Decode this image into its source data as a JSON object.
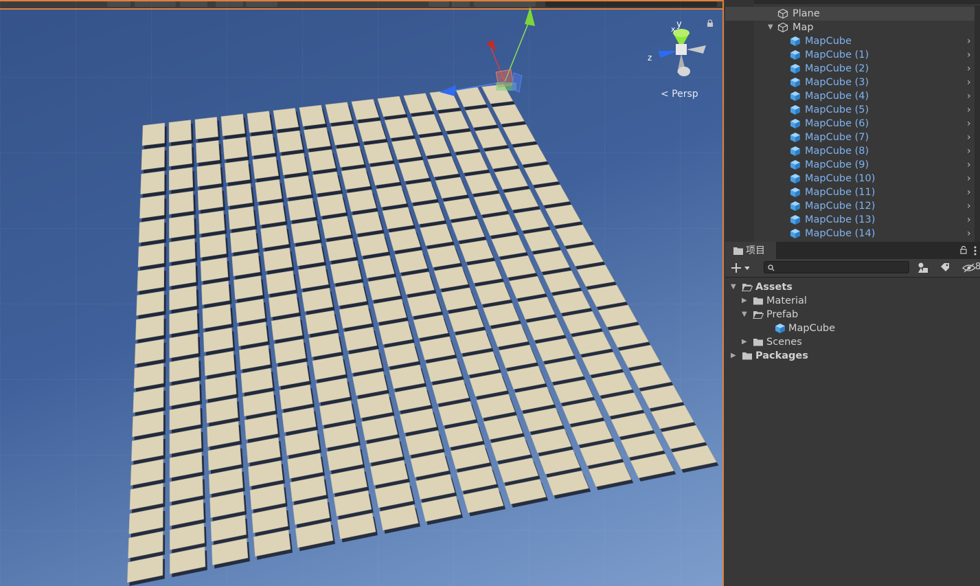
{
  "scene": {
    "projection_label": "< Persp",
    "gizmo_axes": {
      "y": "y",
      "x": "x",
      "z": "z"
    },
    "tile_grid": {
      "rows": 19,
      "cols": 14
    }
  },
  "hierarchy": {
    "items": [
      {
        "label": "Plane",
        "selected": true
      },
      {
        "label": "Map",
        "expanded": true
      },
      {
        "label": "MapCube"
      },
      {
        "label": "MapCube (1)"
      },
      {
        "label": "MapCube (2)"
      },
      {
        "label": "MapCube (3)"
      },
      {
        "label": "MapCube (4)"
      },
      {
        "label": "MapCube (5)"
      },
      {
        "label": "MapCube (6)"
      },
      {
        "label": "MapCube (7)"
      },
      {
        "label": "MapCube (8)"
      },
      {
        "label": "MapCube (9)"
      },
      {
        "label": "MapCube (10)"
      },
      {
        "label": "MapCube (11)"
      },
      {
        "label": "MapCube (12)"
      },
      {
        "label": "MapCube (13)"
      },
      {
        "label": "MapCube (14)"
      }
    ]
  },
  "project": {
    "tab_label": "项目",
    "search": {
      "value": "",
      "placeholder": ""
    },
    "hidden_count": "8",
    "tree": [
      {
        "label": "Assets",
        "bold": true,
        "expanded": true
      },
      {
        "label": "Material"
      },
      {
        "label": "Prefab",
        "expanded": true
      },
      {
        "label": "MapCube"
      },
      {
        "label": "Scenes"
      },
      {
        "label": "Packages",
        "bold": true
      }
    ]
  },
  "colors": {
    "accent": "#e0813a",
    "prefab_text": "#7fb3f0",
    "tile": "#ddd4b8",
    "sky_top": "#35538a",
    "sky_bottom": "#7d9dcc"
  }
}
